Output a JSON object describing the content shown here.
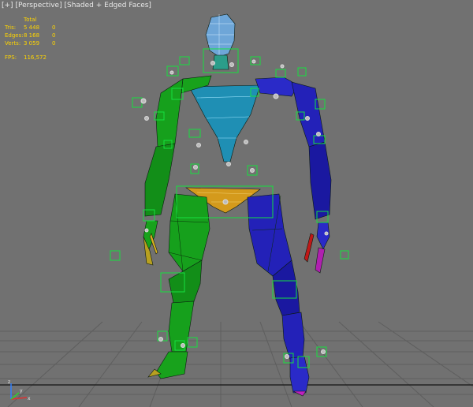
{
  "viewport": {
    "label_parts": [
      "[+]",
      "[Perspective]",
      "[Shaded + Edged Faces]"
    ],
    "stats": {
      "header": "Total",
      "rows": [
        {
          "label": "Tris:",
          "total": "5 448",
          "selected": "0"
        },
        {
          "label": "Edges:",
          "total": "8 168",
          "selected": "0"
        },
        {
          "label": "Verts:",
          "total": "3 059",
          "selected": "0"
        }
      ],
      "fps_label": "FPS:",
      "fps_value": "116,572"
    },
    "axis_tripod": {
      "x": "x",
      "y": "y",
      "z": "z"
    }
  },
  "colors": {
    "background": "#717171",
    "grid": "#5a5a5a",
    "stats_text": "#ffd500",
    "head": "#6ea6d8",
    "torso": "#1f8fb4",
    "left_side": "#16a01c",
    "right_side": "#2321b8",
    "pelvis": "#d49a1c",
    "helper": "#16e040"
  }
}
